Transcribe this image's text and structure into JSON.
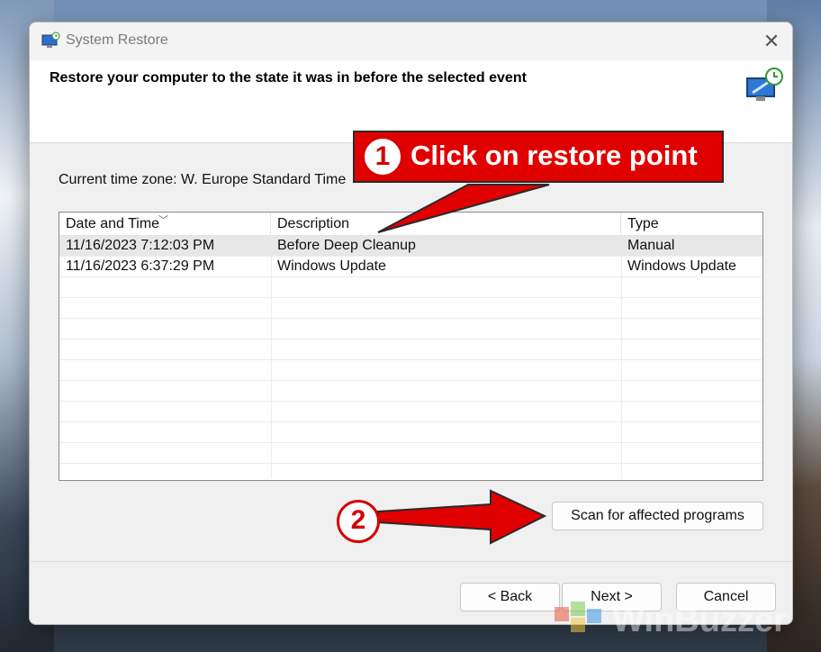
{
  "window": {
    "title": "System Restore",
    "close_symbol": "✕"
  },
  "header": {
    "instruction": "Restore your computer to the state it was in before the selected event"
  },
  "timezone": "Current time zone: W. Europe Standard Time",
  "table": {
    "columns": [
      "Date and Time",
      "Description",
      "Type"
    ],
    "sort_column": "Date and Time",
    "rows": [
      {
        "date": "11/16/2023 7:12:03 PM",
        "description": "Before Deep Cleanup",
        "type": "Manual",
        "selected": true
      },
      {
        "date": "11/16/2023 6:37:29 PM",
        "description": "Windows Update",
        "type": "Windows Update",
        "selected": false
      }
    ]
  },
  "buttons": {
    "scan": "Scan for affected programs",
    "back": "< Back",
    "next": "Next >",
    "cancel": "Cancel"
  },
  "annotations": {
    "step1_number": "1",
    "step1_text": "Click on restore point",
    "step2_number": "2",
    "color": "#e00000"
  },
  "watermark": {
    "text": "WinBuzzer"
  },
  "icons": {
    "title": "system-restore-icon",
    "header": "system-restore-large-icon",
    "close": "close-icon",
    "sort": "sort-down-icon"
  }
}
